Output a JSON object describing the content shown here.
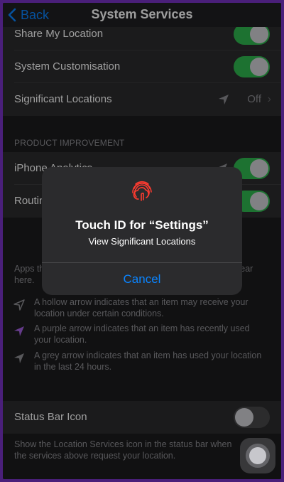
{
  "nav": {
    "back_label": "Back",
    "title": "System Services"
  },
  "group1": {
    "rows": [
      {
        "label": "Share My Location",
        "toggle": "on"
      },
      {
        "label": "System Customisation",
        "toggle": "on"
      },
      {
        "label": "Significant Locations",
        "value": "Off",
        "chevron": "›",
        "icon": "location-arrow-icon"
      }
    ]
  },
  "product_improvement": {
    "header": "PRODUCT IMPROVEMENT",
    "rows": [
      {
        "label": "iPhone Analytics",
        "toggle": "on",
        "icon": "location-arrow-icon"
      },
      {
        "label": "Routing & Traffic",
        "toggle": "on"
      }
    ]
  },
  "legend": {
    "intro": "Apps that have requested access to your location will appear here.",
    "items": [
      {
        "icon": "hollow-arrow-icon",
        "color": "#8e8e93",
        "text": "A hollow arrow indicates that an item may receive your location under certain conditions."
      },
      {
        "icon": "purple-arrow-icon",
        "color": "#a35fe0",
        "text": "A purple arrow indicates that an item has recently used your location."
      },
      {
        "icon": "grey-arrow-icon",
        "color": "#8e8e93",
        "text": "A grey arrow indicates that an item has used your location in the last 24 hours."
      }
    ]
  },
  "status_bar": {
    "label": "Status Bar Icon",
    "toggle": "off",
    "footer": "Show the Location Services icon in the status bar when the services above request your location."
  },
  "alert": {
    "icon": "fingerprint-icon",
    "title": "Touch ID for “Settings”",
    "message": "View Significant Locations",
    "cancel_label": "Cancel"
  },
  "colors": {
    "accent": "#0a84ff",
    "toggle_on": "#30b950",
    "fingerprint": "#ff3b30",
    "frame_border": "#4a1f7a"
  }
}
